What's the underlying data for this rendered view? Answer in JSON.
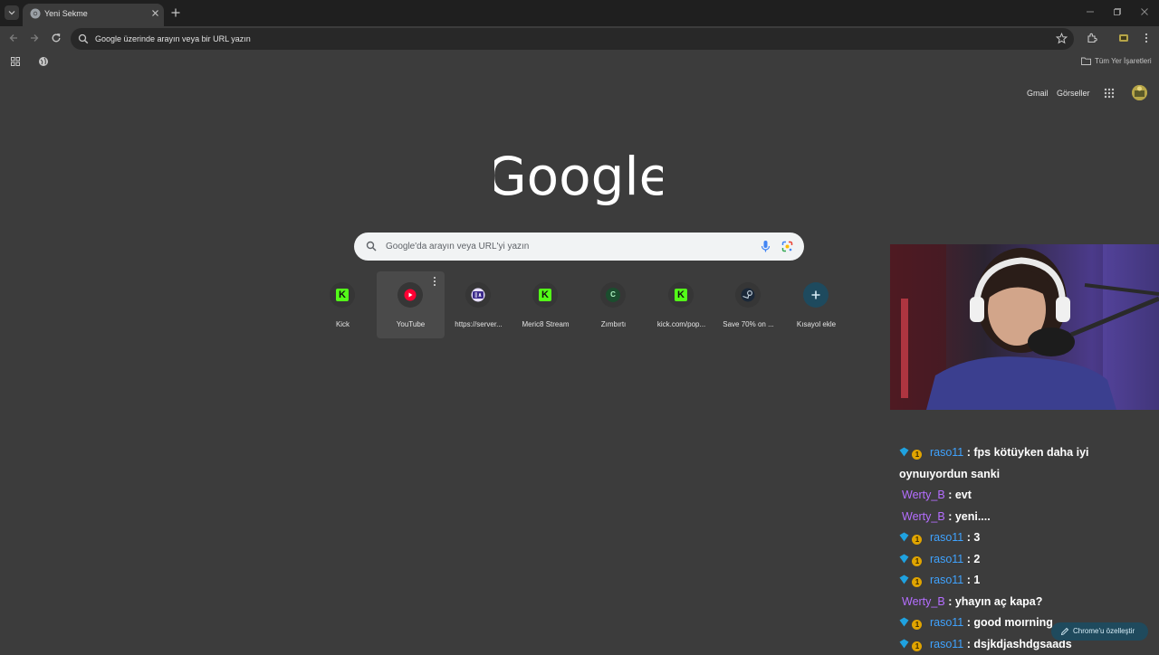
{
  "tab": {
    "title": "Yeni Sekme"
  },
  "omnibox": {
    "text": "Google üzerinde arayın veya bir URL yazın"
  },
  "bookmarks": {
    "all_label": "Tüm Yer İşaretleri"
  },
  "header_links": {
    "gmail": "Gmail",
    "images": "Görseller"
  },
  "logo": {
    "text": "Google"
  },
  "search": {
    "placeholder": "Google'da arayın veya URL'yi yazın"
  },
  "shortcuts": [
    {
      "label": "Kick",
      "icon": "kick-icon"
    },
    {
      "label": "YouTube",
      "icon": "youtube-icon"
    },
    {
      "label": "https://server...",
      "icon": "sa-icon"
    },
    {
      "label": "Meric8 Stream",
      "icon": "kick-icon"
    },
    {
      "label": "Zımbırtı",
      "icon": "c-icon"
    },
    {
      "label": "kick.com/pop...",
      "icon": "kick-icon"
    },
    {
      "label": "Save 70% on ...",
      "icon": "steam-icon"
    },
    {
      "label": "Kısayol ekle",
      "icon": "plus-icon"
    }
  ],
  "chat": [
    {
      "user": "raso11",
      "text": ": fps kötüyken daha iyi oynuıyordun sanki",
      "color": "#3fa3ff",
      "badges": true
    },
    {
      "user": "Werty_B",
      "text": ": evt",
      "color": "#b56eff",
      "badges": false
    },
    {
      "user": "Werty_B",
      "text": ": yeni....",
      "color": "#b56eff",
      "badges": false
    },
    {
      "user": "raso11",
      "text": ": 3",
      "color": "#3fa3ff",
      "badges": true
    },
    {
      "user": "raso11",
      "text": ": 2",
      "color": "#3fa3ff",
      "badges": true
    },
    {
      "user": "raso11",
      "text": ": 1",
      "color": "#3fa3ff",
      "badges": true
    },
    {
      "user": "Werty_B",
      "text": ": yhayın aç kapa?",
      "color": "#b56eff",
      "badges": false
    },
    {
      "user": "raso11",
      "text": ": good moırning",
      "color": "#3fa3ff",
      "badges": true
    },
    {
      "user": "raso11",
      "text": ": dsjkdjashdgsaads",
      "color": "#3fa3ff",
      "badges": true
    }
  ],
  "customize": {
    "label": "Chrome'u özelleştir"
  },
  "colors": {
    "page_bg": "#3c3c3c",
    "tabstrip_bg": "#1f1f1f",
    "kick_green": "#53fc18",
    "accent_blue": "#3fa3ff"
  }
}
